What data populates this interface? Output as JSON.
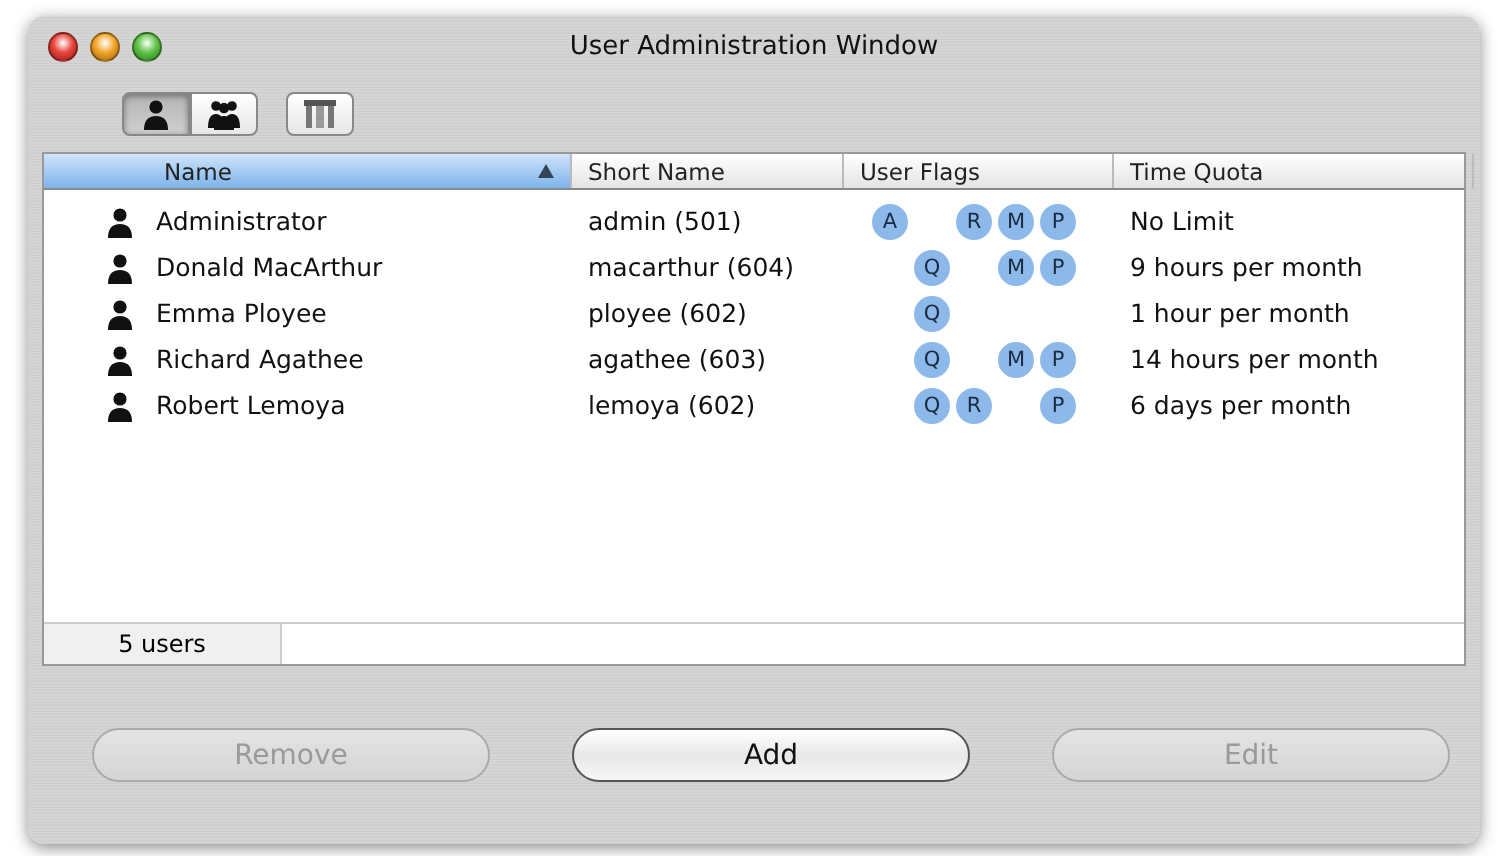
{
  "window": {
    "title": "User Administration Window"
  },
  "view_buttons": [
    {
      "kind": "user",
      "selected": true
    },
    {
      "kind": "group",
      "selected": false
    }
  ],
  "table": {
    "columns": [
      {
        "label": "Name",
        "sorted": true
      },
      {
        "label": "Short Name",
        "sorted": false
      },
      {
        "label": "User Flags",
        "sorted": false
      },
      {
        "label": "Time Quota",
        "sorted": false
      }
    ],
    "rows": [
      {
        "name": "Administrator",
        "short_name": "admin (501)",
        "flags": {
          "a": "A",
          "r": "R",
          "m": "M",
          "p": "P"
        },
        "quota": "No Limit"
      },
      {
        "name": "Donald MacArthur",
        "short_name": "macarthur (604)",
        "flags": {
          "q": "Q",
          "m": "M",
          "p": "P"
        },
        "quota": "9 hours per month"
      },
      {
        "name": "Emma Ployee",
        "short_name": "ployee (602)",
        "flags": {
          "q": "Q"
        },
        "quota": "1 hour per month"
      },
      {
        "name": "Richard Agathee",
        "short_name": "agathee (603)",
        "flags": {
          "q": "Q",
          "m": "M",
          "p": "P"
        },
        "quota": "14 hours per month"
      },
      {
        "name": "Robert Lemoya",
        "short_name": "lemoya (602)",
        "flags": {
          "q": "Q",
          "r": "R",
          "p": "P"
        },
        "quota": "6 days per month"
      }
    ]
  },
  "status_bar": {
    "count": "5 users"
  },
  "buttons": [
    {
      "label": "Remove",
      "disabled": true
    },
    {
      "label": "Add",
      "disabled": false
    },
    {
      "label": "Edit",
      "disabled": true
    }
  ]
}
